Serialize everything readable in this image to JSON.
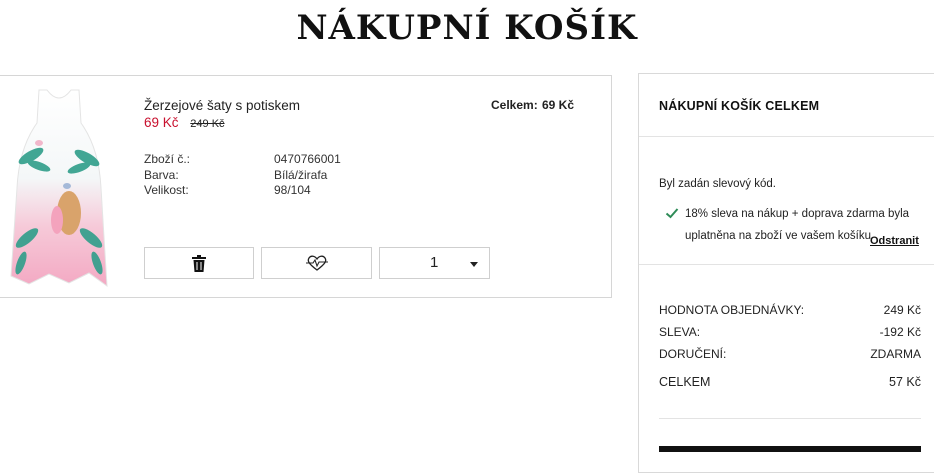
{
  "page": {
    "title": "NÁKUPNÍ KOŠÍK"
  },
  "cart_item": {
    "name": "Žerzejové šaty s potiskem",
    "price_current": "69 Kč",
    "price_original": "249 Kč",
    "total_label": "Celkem:",
    "total_value": "69 Kč",
    "details": [
      {
        "label": "Zboží č.:",
        "value": "0470766001"
      },
      {
        "label": "Barva:",
        "value": "Bílá/žirafa"
      },
      {
        "label": "Velikost:",
        "value": "98/104"
      }
    ],
    "quantity": "1",
    "icons": {
      "delete": "trash-icon",
      "wishlist": "heart-icon",
      "select": "caret-down-icon"
    }
  },
  "summary": {
    "title": "NÁKUPNÍ KOŠÍK CELKEM",
    "discount_info": "Byl zadán slevový kód.",
    "discount_message": "18% sleva na nákup + doprava zdarma byla uplatněna na zboží ve vašem košíku",
    "remove_label": "Odstranit",
    "rows": [
      {
        "label": "HODNOTA OBJEDNÁVKY:",
        "value": "249 Kč"
      },
      {
        "label": "SLEVA:",
        "value": "-192 Kč"
      },
      {
        "label": "DORUČENÍ:",
        "value": "ZDARMA"
      },
      {
        "label": "CELKEM",
        "value": "57 Kč"
      }
    ]
  },
  "colors": {
    "sale_price": "#c8102e",
    "check": "#2e8b57",
    "checkout": "#111111"
  }
}
